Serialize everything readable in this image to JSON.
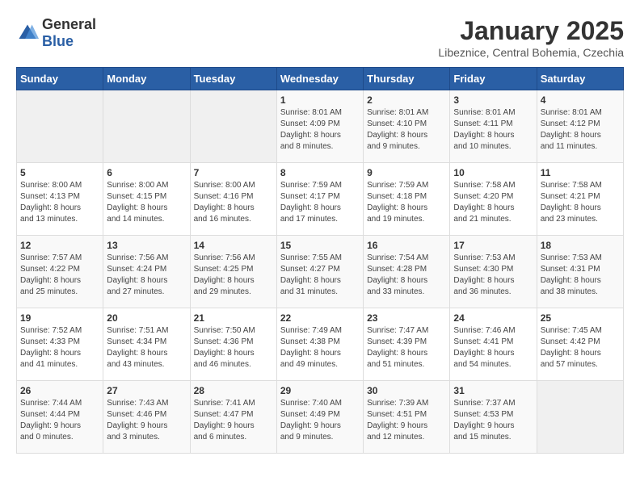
{
  "logo": {
    "general": "General",
    "blue": "Blue"
  },
  "header": {
    "month": "January 2025",
    "location": "Libeznice, Central Bohemia, Czechia"
  },
  "weekdays": [
    "Sunday",
    "Monday",
    "Tuesday",
    "Wednesday",
    "Thursday",
    "Friday",
    "Saturday"
  ],
  "weeks": [
    [
      {
        "day": "",
        "info": ""
      },
      {
        "day": "",
        "info": ""
      },
      {
        "day": "",
        "info": ""
      },
      {
        "day": "1",
        "info": "Sunrise: 8:01 AM\nSunset: 4:09 PM\nDaylight: 8 hours\nand 8 minutes."
      },
      {
        "day": "2",
        "info": "Sunrise: 8:01 AM\nSunset: 4:10 PM\nDaylight: 8 hours\nand 9 minutes."
      },
      {
        "day": "3",
        "info": "Sunrise: 8:01 AM\nSunset: 4:11 PM\nDaylight: 8 hours\nand 10 minutes."
      },
      {
        "day": "4",
        "info": "Sunrise: 8:01 AM\nSunset: 4:12 PM\nDaylight: 8 hours\nand 11 minutes."
      }
    ],
    [
      {
        "day": "5",
        "info": "Sunrise: 8:00 AM\nSunset: 4:13 PM\nDaylight: 8 hours\nand 13 minutes."
      },
      {
        "day": "6",
        "info": "Sunrise: 8:00 AM\nSunset: 4:15 PM\nDaylight: 8 hours\nand 14 minutes."
      },
      {
        "day": "7",
        "info": "Sunrise: 8:00 AM\nSunset: 4:16 PM\nDaylight: 8 hours\nand 16 minutes."
      },
      {
        "day": "8",
        "info": "Sunrise: 7:59 AM\nSunset: 4:17 PM\nDaylight: 8 hours\nand 17 minutes."
      },
      {
        "day": "9",
        "info": "Sunrise: 7:59 AM\nSunset: 4:18 PM\nDaylight: 8 hours\nand 19 minutes."
      },
      {
        "day": "10",
        "info": "Sunrise: 7:58 AM\nSunset: 4:20 PM\nDaylight: 8 hours\nand 21 minutes."
      },
      {
        "day": "11",
        "info": "Sunrise: 7:58 AM\nSunset: 4:21 PM\nDaylight: 8 hours\nand 23 minutes."
      }
    ],
    [
      {
        "day": "12",
        "info": "Sunrise: 7:57 AM\nSunset: 4:22 PM\nDaylight: 8 hours\nand 25 minutes."
      },
      {
        "day": "13",
        "info": "Sunrise: 7:56 AM\nSunset: 4:24 PM\nDaylight: 8 hours\nand 27 minutes."
      },
      {
        "day": "14",
        "info": "Sunrise: 7:56 AM\nSunset: 4:25 PM\nDaylight: 8 hours\nand 29 minutes."
      },
      {
        "day": "15",
        "info": "Sunrise: 7:55 AM\nSunset: 4:27 PM\nDaylight: 8 hours\nand 31 minutes."
      },
      {
        "day": "16",
        "info": "Sunrise: 7:54 AM\nSunset: 4:28 PM\nDaylight: 8 hours\nand 33 minutes."
      },
      {
        "day": "17",
        "info": "Sunrise: 7:53 AM\nSunset: 4:30 PM\nDaylight: 8 hours\nand 36 minutes."
      },
      {
        "day": "18",
        "info": "Sunrise: 7:53 AM\nSunset: 4:31 PM\nDaylight: 8 hours\nand 38 minutes."
      }
    ],
    [
      {
        "day": "19",
        "info": "Sunrise: 7:52 AM\nSunset: 4:33 PM\nDaylight: 8 hours\nand 41 minutes."
      },
      {
        "day": "20",
        "info": "Sunrise: 7:51 AM\nSunset: 4:34 PM\nDaylight: 8 hours\nand 43 minutes."
      },
      {
        "day": "21",
        "info": "Sunrise: 7:50 AM\nSunset: 4:36 PM\nDaylight: 8 hours\nand 46 minutes."
      },
      {
        "day": "22",
        "info": "Sunrise: 7:49 AM\nSunset: 4:38 PM\nDaylight: 8 hours\nand 49 minutes."
      },
      {
        "day": "23",
        "info": "Sunrise: 7:47 AM\nSunset: 4:39 PM\nDaylight: 8 hours\nand 51 minutes."
      },
      {
        "day": "24",
        "info": "Sunrise: 7:46 AM\nSunset: 4:41 PM\nDaylight: 8 hours\nand 54 minutes."
      },
      {
        "day": "25",
        "info": "Sunrise: 7:45 AM\nSunset: 4:42 PM\nDaylight: 8 hours\nand 57 minutes."
      }
    ],
    [
      {
        "day": "26",
        "info": "Sunrise: 7:44 AM\nSunset: 4:44 PM\nDaylight: 9 hours\nand 0 minutes."
      },
      {
        "day": "27",
        "info": "Sunrise: 7:43 AM\nSunset: 4:46 PM\nDaylight: 9 hours\nand 3 minutes."
      },
      {
        "day": "28",
        "info": "Sunrise: 7:41 AM\nSunset: 4:47 PM\nDaylight: 9 hours\nand 6 minutes."
      },
      {
        "day": "29",
        "info": "Sunrise: 7:40 AM\nSunset: 4:49 PM\nDaylight: 9 hours\nand 9 minutes."
      },
      {
        "day": "30",
        "info": "Sunrise: 7:39 AM\nSunset: 4:51 PM\nDaylight: 9 hours\nand 12 minutes."
      },
      {
        "day": "31",
        "info": "Sunrise: 7:37 AM\nSunset: 4:53 PM\nDaylight: 9 hours\nand 15 minutes."
      },
      {
        "day": "",
        "info": ""
      }
    ]
  ]
}
